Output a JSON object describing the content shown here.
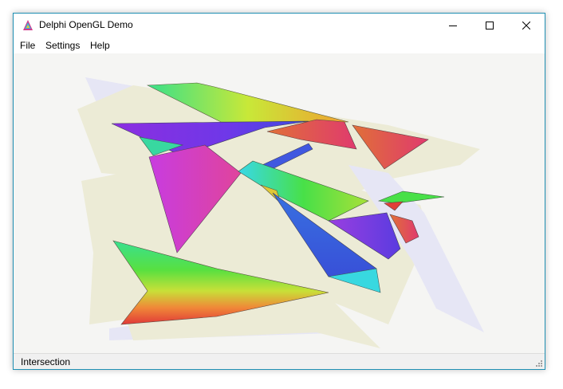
{
  "window": {
    "title": "Delphi OpenGL Demo",
    "app_icon": "delphi-app-icon",
    "caption_buttons": [
      "minimize-icon",
      "maximize-icon",
      "close-icon"
    ]
  },
  "menu": {
    "file": "File",
    "settings": "Settings",
    "help": "Help"
  },
  "status": {
    "text": "Intersection"
  },
  "colors": {
    "frame_border": "#1f8fb3",
    "viewport_bg": "#f5f5f3",
    "shadow_tan": "#ecebd6",
    "shadow_lavender": "#e6e6f5"
  }
}
